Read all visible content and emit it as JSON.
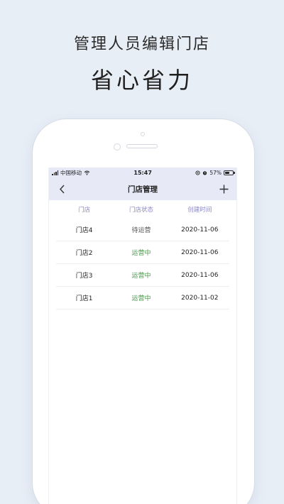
{
  "promo": {
    "headline": "管理人员编辑门店",
    "slogan": "省心省力"
  },
  "status_bar": {
    "carrier": "中国移动",
    "time": "15:47",
    "battery": "57%",
    "battery_level": 0.57
  },
  "nav": {
    "title": "门店管理",
    "back_icon": "chevron-left-icon",
    "add_icon": "plus-icon"
  },
  "table": {
    "headers": [
      "门店",
      "门店状态",
      "创建时间"
    ],
    "rows": [
      {
        "store": "门店4",
        "status": "待运营",
        "status_type": "waiting",
        "created": "2020-11-06"
      },
      {
        "store": "门店2",
        "status": "运营中",
        "status_type": "operating",
        "created": "2020-11-06"
      },
      {
        "store": "门店3",
        "status": "运营中",
        "status_type": "operating",
        "created": "2020-11-06"
      },
      {
        "store": "门店1",
        "status": "运营中",
        "status_type": "operating",
        "created": "2020-11-02"
      }
    ]
  },
  "colors": {
    "background": "#e8eef6",
    "header_bg": "#e7e9f7",
    "column_header": "#8a86c8",
    "status_operating": "#4a9a4a",
    "status_waiting": "#555555"
  }
}
